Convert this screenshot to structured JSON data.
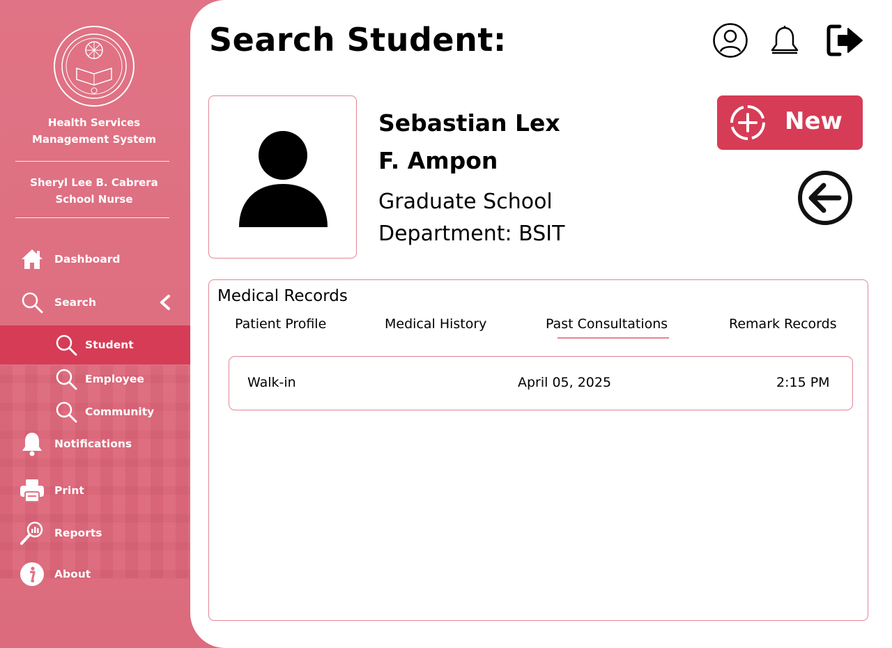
{
  "sidebar": {
    "app_name_line1": "Health Services",
    "app_name_line2": "Management System",
    "user_name": "Sheryl Lee B. Cabrera",
    "user_role": "School Nurse",
    "items": [
      {
        "label": "Dashboard",
        "icon": "home-icon"
      },
      {
        "label": "Search",
        "icon": "search-icon"
      },
      {
        "label": "Student",
        "icon": "search-icon",
        "active": true
      },
      {
        "label": "Employee",
        "icon": "search-icon"
      },
      {
        "label": "Community",
        "icon": "search-icon"
      },
      {
        "label": "Notifications",
        "icon": "bell-icon"
      },
      {
        "label": "Print",
        "icon": "printer-icon"
      },
      {
        "label": "Reports",
        "icon": "reports-icon"
      },
      {
        "label": "About",
        "icon": "info-icon"
      }
    ]
  },
  "header": {
    "title": "Search Student:"
  },
  "profile": {
    "name_line1": "Sebastian Lex",
    "name_line2": "F. Ampon",
    "school": "Graduate School",
    "department": "Department: BSIT"
  },
  "actions": {
    "new_label": "New"
  },
  "records": {
    "title": "Medical Records",
    "tabs": [
      "Patient Profile",
      "Medical History",
      "Past Consultations",
      "Remark Records"
    ],
    "active_tab": "Past Consultations",
    "rows": [
      {
        "type": "Walk-in",
        "date": "April 05, 2025",
        "time": "2:15 PM"
      }
    ]
  },
  "colors": {
    "accent": "#d63c56",
    "sidebar": "#e07385",
    "border": "#e38595"
  }
}
